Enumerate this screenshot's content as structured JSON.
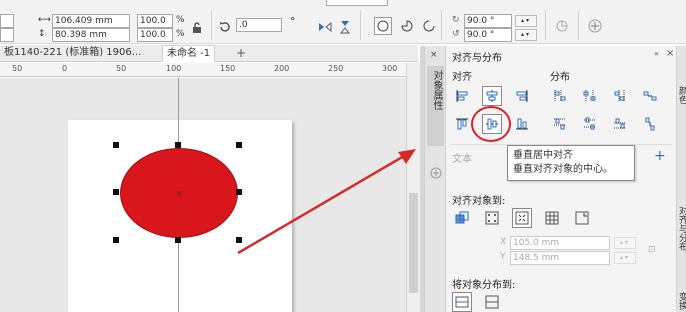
{
  "property_bar": {
    "width_value": "106.409 mm",
    "height_value": "80.398 mm",
    "scale_x": "100.0",
    "scale_y": "100.0",
    "percent": "%",
    "rotation_value": ".0",
    "degree_symbol": "°",
    "arc_start": "90.0 °",
    "arc_end": "90.0 °"
  },
  "doc_tabs": {
    "tab1": "板1140-221 (标准箱) 1906...",
    "tab2": "未命名 -1",
    "add": "+"
  },
  "ruler": {
    "ticks": [
      "50",
      "0",
      "50",
      "100",
      "150",
      "200",
      "250",
      "300"
    ]
  },
  "vertical_tabs": [
    "对象属性"
  ],
  "docker": {
    "title": "对齐与分布",
    "align_section": "对齐",
    "distribute_section": "分布",
    "text_label": "文本",
    "align_to_label": "对齐对象到:",
    "x_value": "105.0 mm",
    "y_value": "148.5 mm",
    "distribute_to_label": "将对象分布到:"
  },
  "right_tabs": [
    "颜色",
    "对齐与分布",
    "变换"
  ],
  "tooltip": {
    "title": "垂直居中对齐",
    "description": "垂直对齐对象的中心。"
  },
  "colors": {
    "ellipse_fill": "#d9161c",
    "arrow": "#d42a2a",
    "highlight_circle": "#e02020",
    "accent": "#2d6fc0"
  }
}
